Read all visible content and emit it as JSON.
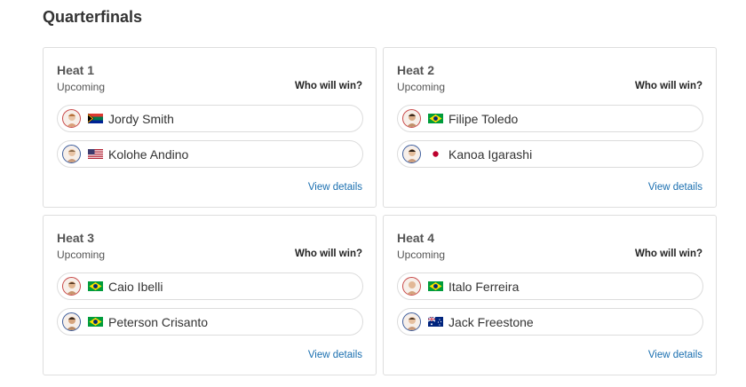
{
  "page": {
    "title": "Quarterfinals"
  },
  "heats": [
    {
      "title": "Heat 1",
      "status": "Upcoming",
      "prompt": "Who will win?",
      "link": "View details",
      "surfers": [
        {
          "name": "Jordy Smith",
          "flag_icon": "south-africa-flag-icon",
          "jersey": "red"
        },
        {
          "name": "Kolohe Andino",
          "flag_icon": "usa-flag-icon",
          "jersey": "blue"
        }
      ]
    },
    {
      "title": "Heat 2",
      "status": "Upcoming",
      "prompt": "Who will win?",
      "link": "View details",
      "surfers": [
        {
          "name": "Filipe Toledo",
          "flag_icon": "brazil-flag-icon",
          "jersey": "red"
        },
        {
          "name": "Kanoa Igarashi",
          "flag_icon": "japan-flag-icon",
          "jersey": "blue"
        }
      ]
    },
    {
      "title": "Heat 3",
      "status": "Upcoming",
      "prompt": "Who will win?",
      "link": "View details",
      "surfers": [
        {
          "name": "Caio Ibelli",
          "flag_icon": "brazil-flag-icon",
          "jersey": "red"
        },
        {
          "name": "Peterson Crisanto",
          "flag_icon": "brazil-flag-icon",
          "jersey": "blue"
        }
      ]
    },
    {
      "title": "Heat 4",
      "status": "Upcoming",
      "prompt": "Who will win?",
      "link": "View details",
      "surfers": [
        {
          "name": "Italo Ferreira",
          "flag_icon": "brazil-flag-icon",
          "jersey": "red"
        },
        {
          "name": "Jack Freestone",
          "flag_icon": "australia-flag-icon",
          "jersey": "blue"
        }
      ]
    }
  ],
  "colors": {
    "link": "#1a6fb0",
    "red_jersey": "#c94b4b",
    "blue_jersey": "#3f5f9e",
    "card_border": "#dedede"
  }
}
